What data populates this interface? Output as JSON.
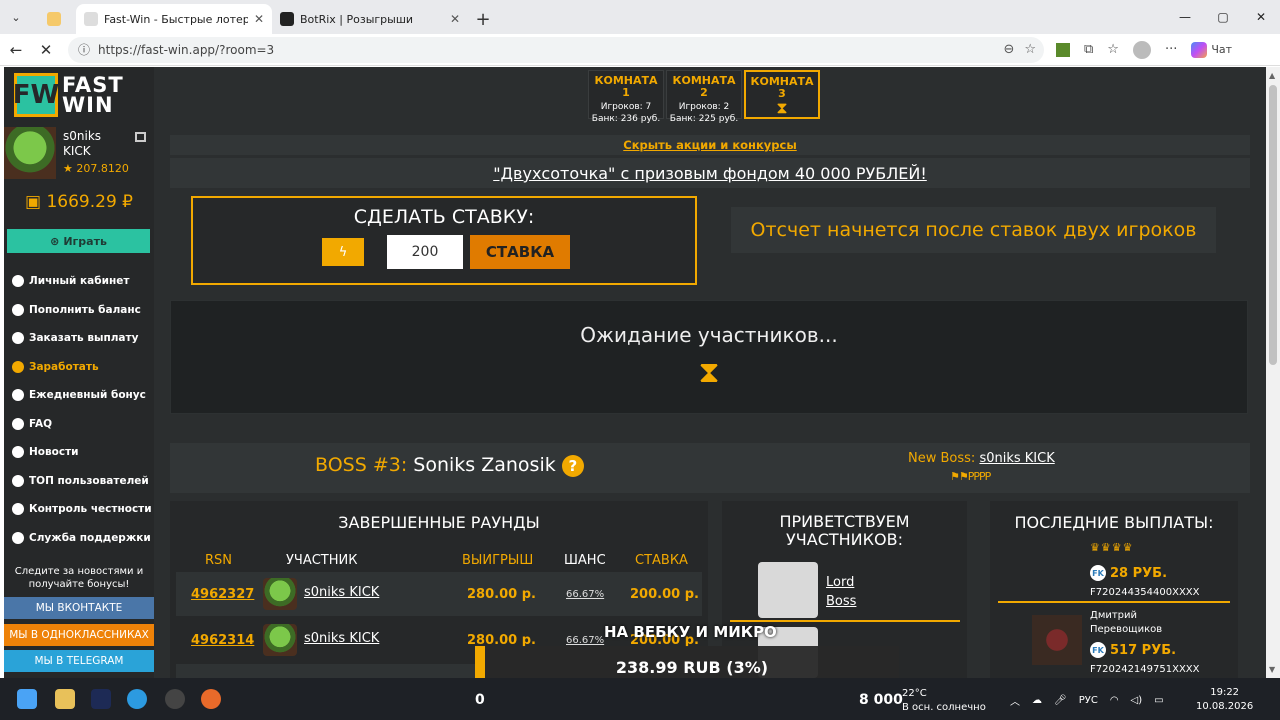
{
  "browser": {
    "tabs": [
      {
        "label": "",
        "type": "pinned"
      },
      {
        "label": "Fast-Win - Быстрые лотереи! Ком",
        "active": true
      },
      {
        "label": "BotRix | Розыгрыши",
        "active": false
      }
    ],
    "url": "https://fast-win.app/?room=3",
    "chat_label": "Чат"
  },
  "logo": {
    "mark": "FW",
    "line1": "FAST",
    "line2": "WIN"
  },
  "user": {
    "name": "s0niks KICK",
    "rating": "★ 207.8120",
    "balance": "1669.29 ₽"
  },
  "play_button": "Играть",
  "menu": [
    "Личный кабинет",
    "Пополнить баланс",
    "Заказать выплату",
    "Заработать",
    "Ежедневный бонус",
    "FAQ",
    "Новости",
    "ТОП пользователей",
    "Контроль честности",
    "Служба поддержки"
  ],
  "follow_text": "Следите за новостями и получайте бонусы!",
  "social": {
    "vk": "МЫ ВКОНТАКТЕ",
    "ok": "МЫ В ОДНОКЛАССНИКАХ",
    "tg": "МЫ В TELEGRAM"
  },
  "rooms": [
    {
      "title": "КОМНАТА 1",
      "players": "Игроков: 7",
      "bank": "Банк: 236 руб."
    },
    {
      "title": "КОМНАТА 2",
      "players": "Игроков: 2",
      "bank": "Банк: 225 руб."
    },
    {
      "title": "КОМНАТА 3"
    }
  ],
  "hide_promos": "Скрыть акции и конкурсы",
  "promo": "\"Двухсоточка\" с призовым фондом 40 000 РУБЛЕЙ!",
  "bet": {
    "title": "СДЕЛАТЬ СТАВКУ:",
    "amount": "200",
    "button": "СТАВКА"
  },
  "countdown": "Отсчет начнется после ставок двух игроков",
  "waiting": "Ожидание участников...",
  "boss": {
    "label": "BOSS #3:",
    "name": "Soniks Zanosik",
    "new_boss_label": "New Boss:",
    "new_boss_name": "s0niks KICK",
    "flags": "PPPP"
  },
  "rounds": {
    "title": "ЗАВЕРШЕННЫЕ РАУНДЫ",
    "headers": [
      "RSN",
      "УЧАСТНИК",
      "ВЫИГРЫШ",
      "ШАНС",
      "СТАВКА"
    ],
    "rows": [
      {
        "rsn": "4962327",
        "player": "s0niks KICK",
        "win": "280.00 р.",
        "chance": "66.67%",
        "stake": "200.00 р."
      },
      {
        "rsn": "4962314",
        "player": "s0niks KICK",
        "win": "280.00 р.",
        "chance": "66.67%",
        "stake": "200.00 р."
      }
    ]
  },
  "welcome": {
    "title": "ПРИВЕТСТВУЕМ УЧАСТНИКОВ:",
    "user1": "Lord Boss"
  },
  "payouts": {
    "title": "ПОСЛЕДНИЕ ВЫПЛАТЫ:",
    "items": [
      {
        "amount": "28 РУБ.",
        "account": "F720244354400XXXX"
      },
      {
        "name": "Дмитрий Перевощиков",
        "amount": "517 РУБ.",
        "account": "F720242149751XXXX"
      }
    ]
  },
  "overlay": {
    "text": "НА ВЕБКУ И МИКРО",
    "bar": "238.99 RUB (3%)",
    "left_num": "0",
    "right_num": "8 000"
  },
  "taskbar": {
    "temp": "22°C",
    "weather": "В осн. солнечно",
    "lang": "РУС",
    "time": "19:22",
    "date": "10.08.2026"
  }
}
